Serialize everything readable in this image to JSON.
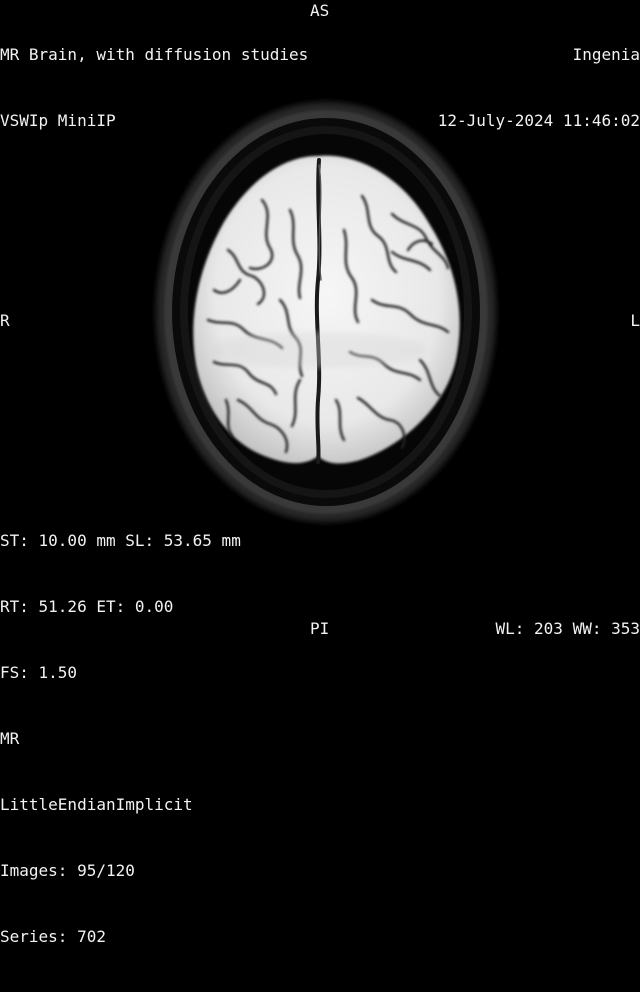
{
  "study": {
    "description": "MR Brain, with diffusion studies",
    "series_name": "VSWIp MiniIP"
  },
  "device": {
    "name": "Ingenia",
    "datetime": "12-July-2024 11:46:02"
  },
  "orientation": {
    "top": "AS",
    "left": "R",
    "right": "L",
    "bottom": "PI"
  },
  "acquisition": {
    "st_sl": "ST: 10.00 mm SL: 53.65 mm",
    "rt_et": "RT: 51.26 ET: 0.00",
    "fs": "FS: 1.50",
    "modality": "MR",
    "transfer_syntax": "LittleEndianImplicit",
    "images": "Images: 95/120",
    "series": "Series: 702"
  },
  "window": {
    "wl_ww": "WL: 203 WW: 353"
  }
}
